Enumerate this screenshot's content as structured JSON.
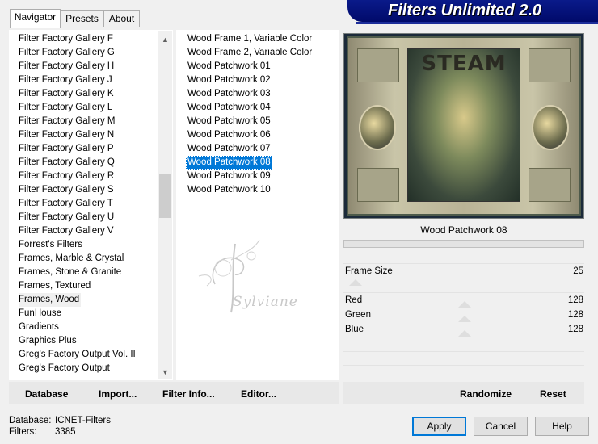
{
  "banner": {
    "title": "Filters Unlimited 2.0"
  },
  "tabs": [
    {
      "label": "Navigator",
      "active": true
    },
    {
      "label": "Presets",
      "active": false
    },
    {
      "label": "About",
      "active": false
    }
  ],
  "categories": [
    "Filter Factory Gallery F",
    "Filter Factory Gallery G",
    "Filter Factory Gallery H",
    "Filter Factory Gallery J",
    "Filter Factory Gallery K",
    "Filter Factory Gallery L",
    "Filter Factory Gallery M",
    "Filter Factory Gallery N",
    "Filter Factory Gallery P",
    "Filter Factory Gallery Q",
    "Filter Factory Gallery R",
    "Filter Factory Gallery S",
    "Filter Factory Gallery T",
    "Filter Factory Gallery U",
    "Filter Factory Gallery V",
    "Forrest's Filters",
    "Frames, Marble & Crystal",
    "Frames, Stone & Granite",
    "Frames, Textured",
    "Frames, Wood",
    "FunHouse",
    "Gradients",
    "Graphics Plus",
    "Greg's Factory Output Vol. II",
    "Greg's Factory Output"
  ],
  "current_category": "Frames, Wood",
  "filters": [
    "Wood Frame 1, Variable Color",
    "Wood Frame 2, Variable Color",
    "Wood Patchwork 01",
    "Wood Patchwork 02",
    "Wood Patchwork 03",
    "Wood Patchwork 04",
    "Wood Patchwork 05",
    "Wood Patchwork 06",
    "Wood Patchwork 07",
    "Wood Patchwork 08",
    "Wood Patchwork 09",
    "Wood Patchwork 10"
  ],
  "selected_filter": "Wood Patchwork 08",
  "watermark": {
    "text": "Sylviane"
  },
  "preview": {
    "filter_name": "Wood Patchwork 08",
    "title_text": "STEAM"
  },
  "parameters": [
    {
      "name": "Frame Size",
      "value": "25"
    },
    {
      "name": "Red",
      "value": "128"
    },
    {
      "name": "Green",
      "value": "128"
    },
    {
      "name": "Blue",
      "value": "128"
    }
  ],
  "actions": {
    "database": "Database",
    "import": "Import...",
    "filter_info": "Filter Info...",
    "editor": "Editor...",
    "randomize": "Randomize",
    "reset": "Reset"
  },
  "status": {
    "database_label": "Database:",
    "database_value": "ICNET-Filters",
    "filters_label": "Filters:",
    "filters_value": "3385"
  },
  "dialog_buttons": {
    "apply": "Apply",
    "cancel": "Cancel",
    "help": "Help"
  }
}
